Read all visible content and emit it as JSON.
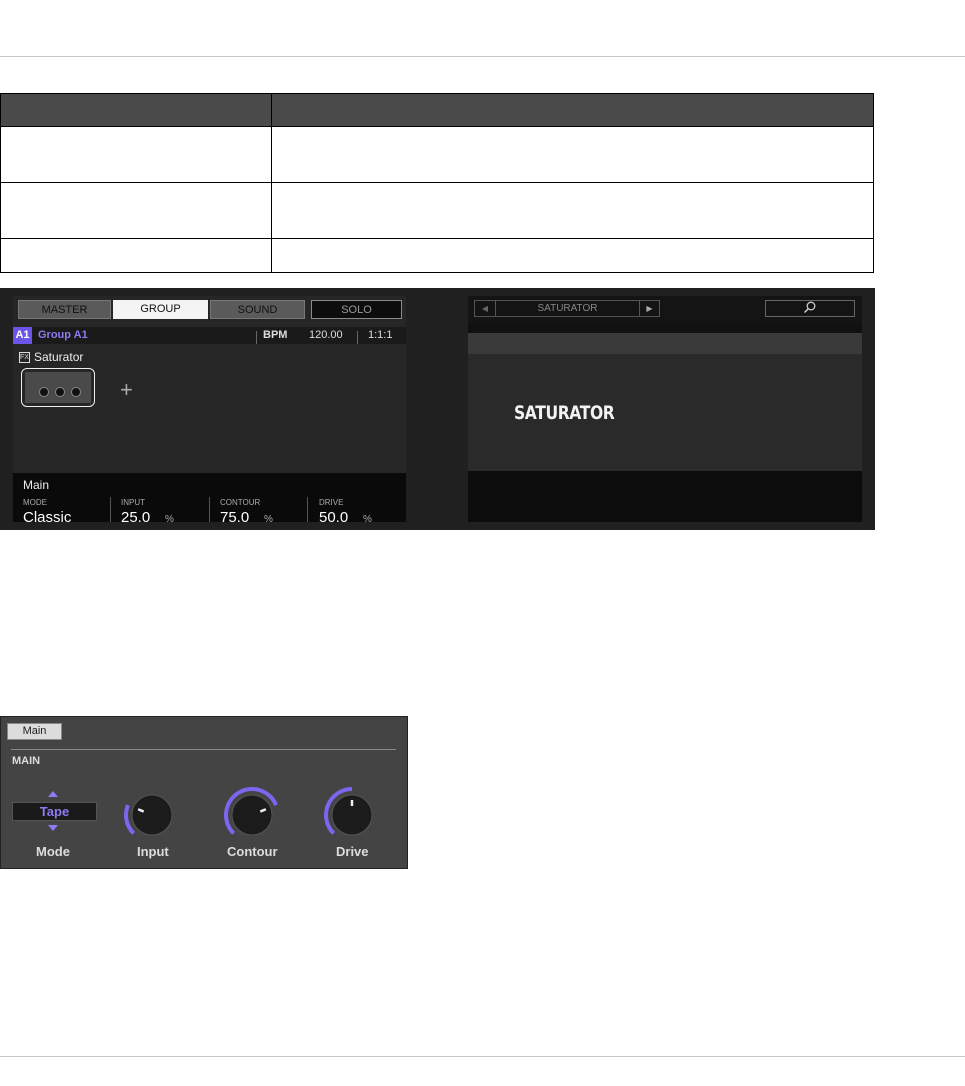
{
  "table": {
    "rows": [
      {
        "col1": "",
        "col2": ""
      },
      {
        "col1": "",
        "col2": ""
      },
      {
        "col1": "",
        "col2": ""
      }
    ]
  },
  "left_screen": {
    "tabs": {
      "master": "MASTER",
      "group": "GROUP",
      "sound": "SOUND",
      "solo": "SOLO"
    },
    "group_badge": "A1",
    "group_name": "Group A1",
    "bpm_label": "BPM",
    "bpm_value": "120.00",
    "position": "1:1:1",
    "fx_badge": "FX",
    "plugin_name": "Saturator",
    "add_symbol": "+",
    "page_name": "Main",
    "params": [
      {
        "label": "MODE",
        "value": "Classic",
        "unit": ""
      },
      {
        "label": "INPUT",
        "value": "25.0",
        "unit": "%"
      },
      {
        "label": "CONTOUR",
        "value": "75.0",
        "unit": "%"
      },
      {
        "label": "DRIVE",
        "value": "50.0",
        "unit": "%"
      }
    ]
  },
  "right_screen": {
    "preset_title": "SATURATOR",
    "search_icon": "search-icon",
    "display_name": "SATURATOR"
  },
  "panel": {
    "tab_label": "Main",
    "heading": "MAIN",
    "mode_value": "Tape",
    "labels": {
      "mode": "Mode",
      "input": "Input",
      "contour": "Contour",
      "drive": "Drive"
    },
    "knob_levels": {
      "input": 0.25,
      "contour": 0.75,
      "drive": 0.5
    }
  },
  "colors": {
    "accent": "#7c66f0",
    "screen_bg": "#262626"
  }
}
